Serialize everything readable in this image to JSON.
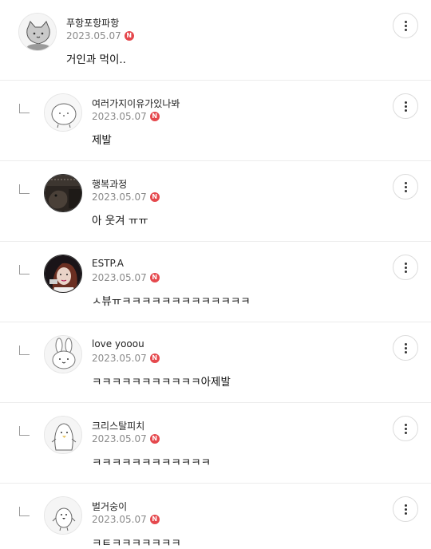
{
  "comments": [
    {
      "nickname": "푸항포항파항",
      "date": "2023.05.07",
      "badge": "N",
      "text": "거인과 먹이..",
      "avatar": "gray-cat-avatar",
      "reply": false
    },
    {
      "nickname": "여러가지이유가있나봐",
      "date": "2023.05.07",
      "badge": "N",
      "text": "제발",
      "avatar": "white-blob-avatar",
      "reply": true
    },
    {
      "nickname": "행복과정",
      "date": "2023.05.07",
      "badge": "N",
      "text": "아 웃겨 ㅠㅠ",
      "avatar": "dark-photo-avatar",
      "reply": true
    },
    {
      "nickname": "ESTP.A",
      "date": "2023.05.07",
      "badge": "N",
      "text": "ㅅ뷰ㅠㅋㅋㅋㅋㅋㅋㅋㅋㅋㅋㅋㅋㅋ",
      "avatar": "person-photo-avatar",
      "reply": true
    },
    {
      "nickname": "love yooou",
      "date": "2023.05.07",
      "badge": "N",
      "text": "ㅋㅋㅋㅋㅋㅋㅋㅋㅋㅋㅋ아제발",
      "avatar": "bunny-avatar",
      "reply": true
    },
    {
      "nickname": "크리스탈피치",
      "date": "2023.05.07",
      "badge": "N",
      "text": "ㅋㅋㅋㅋㅋㅋㅋㅋㅋㅋㅋㅋ",
      "avatar": "penguin-avatar",
      "reply": true
    },
    {
      "nickname": "벌거숭이",
      "date": "2023.05.07",
      "badge": "N",
      "text": "ㅋㅌㅋㅋㅋㅋㅋㅋㅋ",
      "avatar": "bird-avatar",
      "reply": true
    }
  ],
  "colors": {
    "badge": "#e5484d",
    "meta": "#8a8a8a",
    "divider": "#ececec"
  },
  "icons": {
    "more": "more-vertical-icon",
    "reply": "reply-arrow-icon",
    "new": "new-badge"
  }
}
